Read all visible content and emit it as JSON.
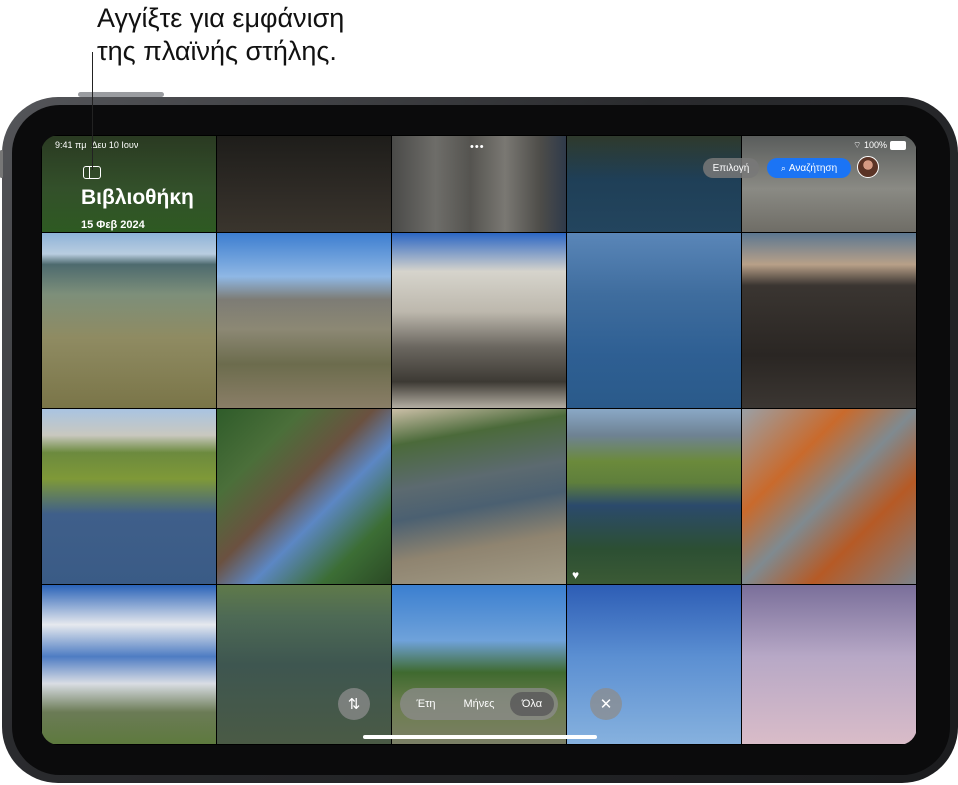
{
  "callout": {
    "line1": "Αγγίξτε για εμφάνιση",
    "line2": "της πλαϊνής στήλης."
  },
  "status": {
    "time": "9:41 πμ",
    "date": "Δευ 10 Ιουν",
    "battery": "100%"
  },
  "header": {
    "title": "Βιβλιοθήκη",
    "subtitle": "15 Φεβ 2024",
    "more_dots": "•••",
    "select_label": "Επιλογή",
    "search_label": "Αναζήτηση"
  },
  "bottom": {
    "sort_icon": "⇅",
    "segments": [
      "Έτη",
      "Μήνες",
      "Όλα"
    ],
    "active_segment": "Όλα",
    "close_icon": "✕"
  },
  "icons": {
    "sidebar": "sidebar-icon",
    "search": "search-icon",
    "wifi": "wifi-icon",
    "battery": "battery-icon",
    "heart": "heart-icon"
  },
  "colors": {
    "accent": "#1b74f5"
  }
}
